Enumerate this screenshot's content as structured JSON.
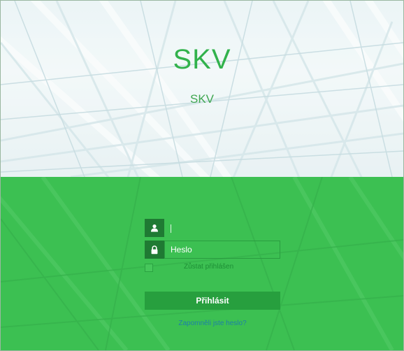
{
  "brand": {
    "title": "SKV",
    "subtitle": "SKV"
  },
  "login": {
    "username": {
      "value": "",
      "icon": "user-icon"
    },
    "password": {
      "placeholder": "Heslo",
      "icon": "lock-icon"
    },
    "remember_label": "Zůstat přihlášen",
    "remember_checked": false,
    "submit_label": "Přihlásit",
    "forgot_label": "Zapomněli jste heslo?"
  },
  "colors": {
    "brand_green": "#32b24c",
    "panel_green": "#3cc052",
    "button_green": "#279f3e",
    "icon_box": "#1f7a33",
    "link_blue": "#1d7fa8"
  }
}
